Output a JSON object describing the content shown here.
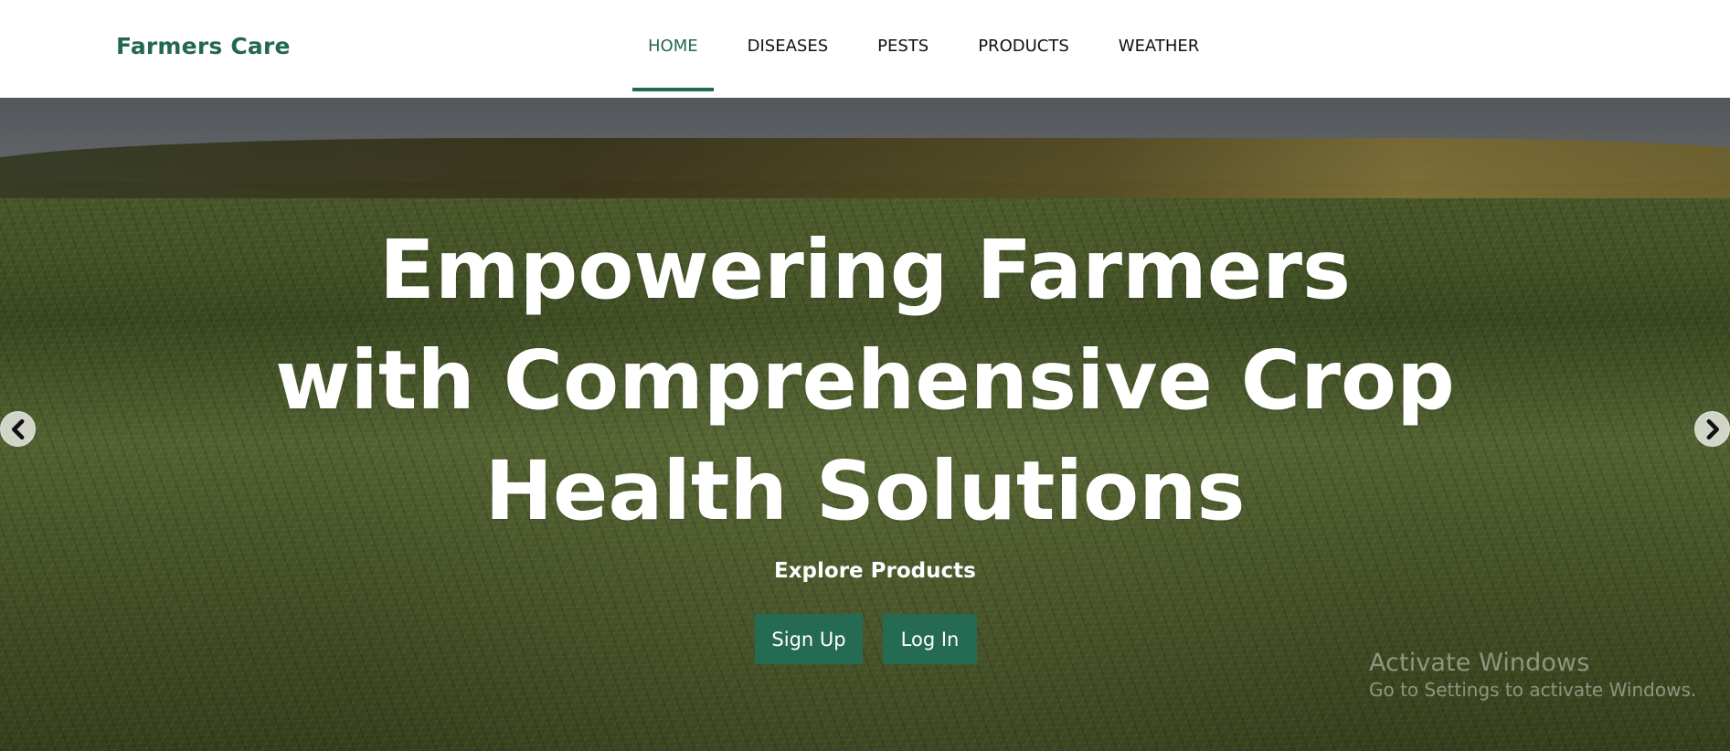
{
  "brand": {
    "name": "Farmers Care",
    "color": "#246850"
  },
  "nav": {
    "items": [
      {
        "label": "HOME",
        "active": true
      },
      {
        "label": "DISEASES",
        "active": false
      },
      {
        "label": "PESTS",
        "active": false
      },
      {
        "label": "PRODUCTS",
        "active": false
      },
      {
        "label": "WEATHER",
        "active": false
      }
    ],
    "active_color": "#246850"
  },
  "hero": {
    "title_lines": [
      "Empowering Farmers",
      "with Comprehensive Crop",
      "Health Solutions"
    ],
    "explore_label": "Explore Products",
    "signup_label": "Sign Up",
    "login_label": "Log In",
    "prev_icon": "chevron-left-icon",
    "next_icon": "chevron-right-icon",
    "button_color": "#256b54"
  },
  "watermark": {
    "title": "Activate Windows",
    "subtitle": "Go to Settings to activate Windows."
  }
}
